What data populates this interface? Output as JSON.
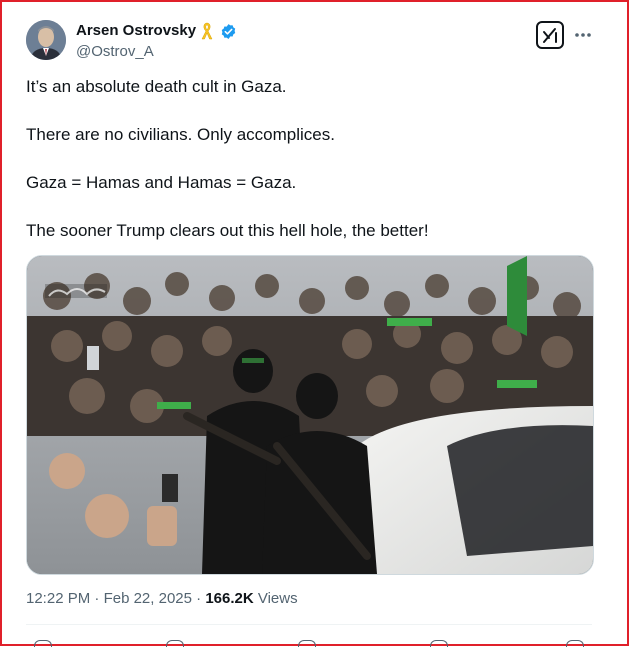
{
  "author": {
    "name": "Arsen Ostrovsky",
    "handle": "@Ostrov_A",
    "badges": [
      "yellow-ribbon-icon",
      "verified-badge-icon"
    ]
  },
  "header_actions": {
    "grok_icon": "grok-icon",
    "more_icon": "more-icon"
  },
  "tweet": {
    "lines": [
      "It’s an absolute death cult in Gaza.",
      "There are no civilians. Only accomplices.",
      "Gaza = Hamas and Hamas = Gaza.",
      "The sooner Trump clears out this hell hole, the better!"
    ]
  },
  "meta": {
    "time": "12:22 PM",
    "separator": "·",
    "date": "Feb 22, 2025",
    "views_count": "166.2K",
    "views_label": "Views"
  },
  "colors": {
    "text_primary": "#0f1419",
    "text_secondary": "#536471",
    "verified": "#1d9bf0",
    "ribbon": "#f7c325",
    "frame_border": "#e0202a"
  }
}
